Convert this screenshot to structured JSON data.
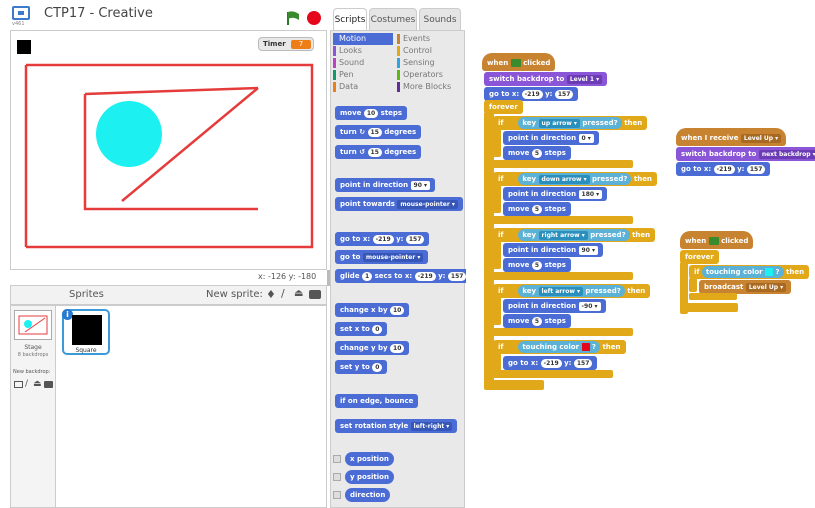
{
  "app": {
    "title": "CTP17 - Creative",
    "version": "v461"
  },
  "stage": {
    "timer_label": "Timer",
    "timer_value": "7",
    "coords": "x: -126  y: -180"
  },
  "sprites": {
    "header": "Sprites",
    "new_sprite": "New sprite:",
    "stage_label": "Stage",
    "stage_sub": "8 backdrops",
    "new_backdrop": "New backdrop:",
    "sprite_name": "Square"
  },
  "tabs": [
    "Scripts",
    "Costumes",
    "Sounds"
  ],
  "categories": [
    {
      "label": "Motion",
      "color": "#4a6cd4"
    },
    {
      "label": "Events",
      "color": "#c88330"
    },
    {
      "label": "Looks",
      "color": "#8a55d7"
    },
    {
      "label": "Control",
      "color": "#e1a91a"
    },
    {
      "label": "Sound",
      "color": "#bb42c3"
    },
    {
      "label": "Sensing",
      "color": "#2ca5e2"
    },
    {
      "label": "Pen",
      "color": "#0e9a6c"
    },
    {
      "label": "Operators",
      "color": "#5cb712"
    },
    {
      "label": "Data",
      "color": "#ee7d16"
    },
    {
      "label": "More Blocks",
      "color": "#632d99"
    }
  ],
  "palette": {
    "move": [
      "move",
      "10",
      "steps"
    ],
    "turn_cw": [
      "turn",
      "15",
      "degrees"
    ],
    "turn_ccw": [
      "turn",
      "15",
      "degrees"
    ],
    "point_dir": [
      "point in direction",
      "90"
    ],
    "point_towards": [
      "point towards",
      "mouse-pointer"
    ],
    "goto_xy": [
      "go to x:",
      "-219",
      "y:",
      "157"
    ],
    "goto": [
      "go to",
      "mouse-pointer"
    ],
    "glide": [
      "glide",
      "1",
      "secs to x:",
      "-219",
      "y:",
      "157"
    ],
    "change_x": [
      "change x by",
      "10"
    ],
    "set_x": [
      "set x to",
      "0"
    ],
    "change_y": [
      "change y by",
      "10"
    ],
    "set_y": [
      "set y to",
      "0"
    ],
    "bounce": "if on edge, bounce",
    "rotation": [
      "set rotation style",
      "left-right"
    ],
    "reporters": [
      "x position",
      "y position",
      "direction"
    ]
  },
  "script1": {
    "hat": [
      "when",
      "clicked"
    ],
    "backdrop": [
      "switch backdrop to",
      "Level 1"
    ],
    "goto": [
      "go to x:",
      "-219",
      "y:",
      "157"
    ],
    "forever": "forever",
    "if_label": "if",
    "then": "then",
    "key": "key",
    "pressed": "pressed?",
    "keys": [
      "up arrow",
      "down arrow",
      "right arrow",
      "left arrow"
    ],
    "dirs": [
      "0",
      "180",
      "90",
      "-90"
    ],
    "point": "point in direction",
    "move": [
      "move",
      "5",
      "steps"
    ],
    "touching": "touching color",
    "goto2": [
      "go to x:",
      "-219",
      "y:",
      "157"
    ]
  },
  "script2": {
    "hat": [
      "when I receive",
      "Level Up"
    ],
    "backdrop": [
      "switch backdrop to",
      "next backdrop"
    ],
    "goto": [
      "go to x:",
      "-219",
      "y:",
      "157"
    ]
  },
  "script3": {
    "hat": [
      "when",
      "clicked"
    ],
    "forever": "forever",
    "if_label": "if",
    "touching": "touching color",
    "then": "then",
    "broadcast": [
      "broadcast",
      "Level Up"
    ]
  }
}
